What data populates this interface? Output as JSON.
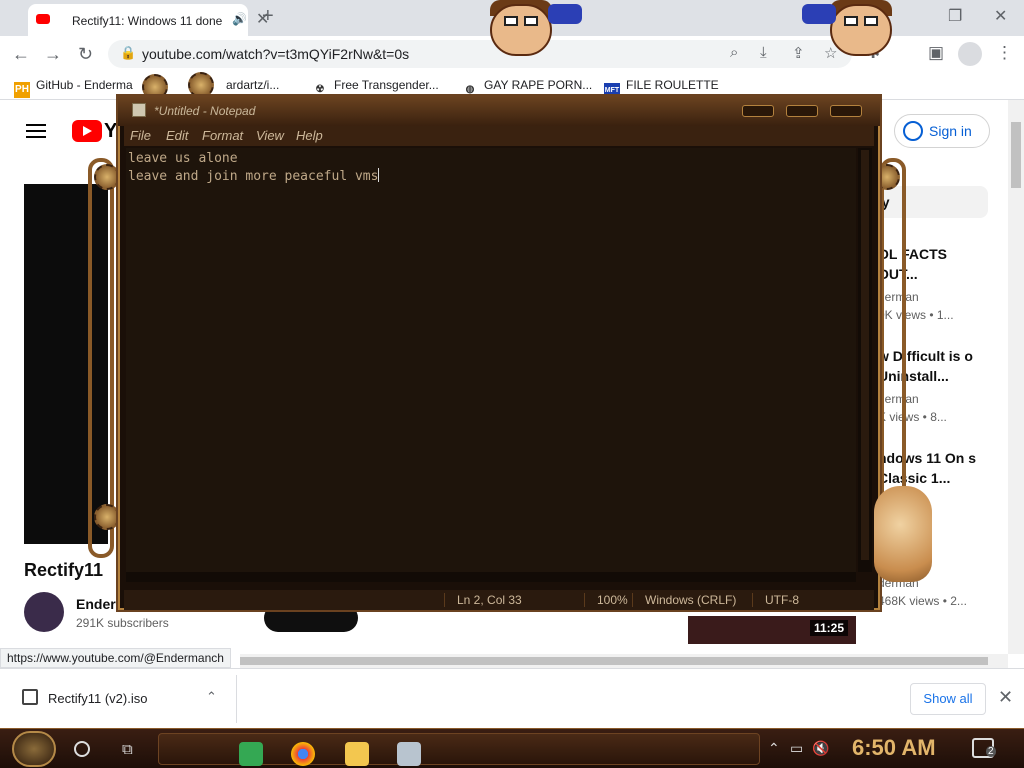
{
  "browser": {
    "tab_title": "Rectify11: Windows 11 done",
    "url": "youtube.com/watch?v=t3mQYiF2rNw&t=0s",
    "bookmarks": [
      {
        "label": "GitHub - Enderma",
        "icon": "PH"
      },
      {
        "label": "ardartz/i...",
        "icon": ""
      },
      {
        "label": "Free Transgender...",
        "icon": ""
      },
      {
        "label": "GAY RAPE PORN...",
        "icon": ""
      },
      {
        "label": "FILE ROULETTE",
        "icon": "MFT"
      }
    ],
    "hover_link": "https://www.youtube.com/@Endermanch"
  },
  "youtube": {
    "logo_letter": "Y",
    "signin": "Sign in",
    "video_title": "Rectify11",
    "channel": "Ender",
    "subscribers": "291K subscribers",
    "chip": "ay",
    "recommendations": [
      {
        "title": "OL FACTS OUT...",
        "channel": "derman",
        "views": "0K views  • 1..."
      },
      {
        "title": "w Difficult is o Uninstall...",
        "channel": "derman",
        "views": "K views  • 8..."
      },
      {
        "title": "ndows 11 On s Classic 1...",
        "channel": "cle",
        "views": "• 1..."
      },
      {
        "title": "dows",
        "channel": "derman",
        "views": "468K views  • 2..."
      }
    ],
    "duration": "11:25"
  },
  "notepad": {
    "title": "*Untitled - Notepad",
    "menu": [
      "File",
      "Edit",
      "Format",
      "View",
      "Help"
    ],
    "content_lines": [
      "leave us alone",
      "leave and join more peaceful vms"
    ],
    "status": {
      "position": "Ln 2, Col 33",
      "zoom": "100%",
      "line_ending": "Windows (CRLF)",
      "encoding": "UTF-8"
    }
  },
  "downloads": {
    "file": "Rectify11 (v2).iso",
    "show_all": "Show all"
  },
  "taskbar": {
    "time": "6:50 AM",
    "notifications": "2"
  }
}
